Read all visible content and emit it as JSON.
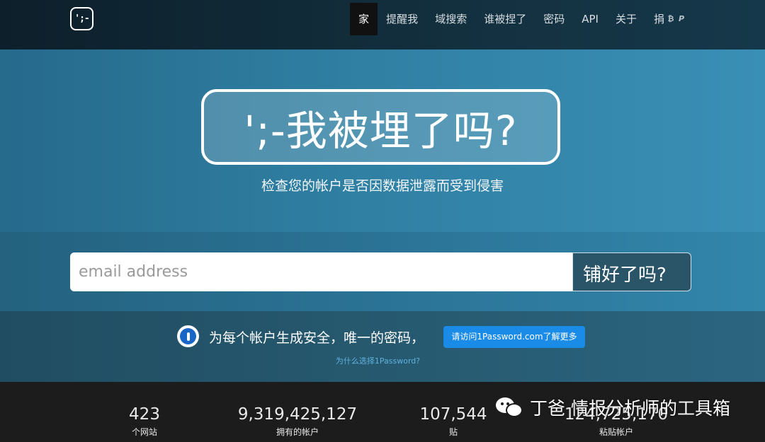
{
  "nav": {
    "logo": "';-",
    "items": [
      {
        "label": "家",
        "active": true
      },
      {
        "label": "提醒我"
      },
      {
        "label": "域搜索"
      },
      {
        "label": "谁被捏了"
      },
      {
        "label": "密码"
      },
      {
        "label": "API"
      },
      {
        "label": "关于"
      },
      {
        "label": "捐"
      }
    ],
    "donate_icons": [
      "bitcoin-icon",
      "paypal-icon"
    ]
  },
  "hero": {
    "title": "';-我被埋了吗?",
    "tagline": "检查您的帐户是否因数据泄露而受到侵害"
  },
  "search": {
    "placeholder": "email address",
    "value": "",
    "button_label": "铺好了吗?"
  },
  "promo": {
    "icon": "1password-icon",
    "text": "为每个帐户生成安全，唯一的密码，",
    "button_label": "请访问1Password.com了解更多",
    "link": "为什么选择1Password?"
  },
  "stats": [
    {
      "value": "423",
      "label": "个网站"
    },
    {
      "value": "9,319,425,127",
      "label": "拥有的帐户"
    },
    {
      "value": "107,544",
      "label": "贴"
    },
    {
      "value": "124,725,170",
      "label": "粘贴帐户"
    }
  ],
  "watermark": {
    "icon": "wechat-icon",
    "text": "丁爸 情报分析师的工具箱"
  }
}
